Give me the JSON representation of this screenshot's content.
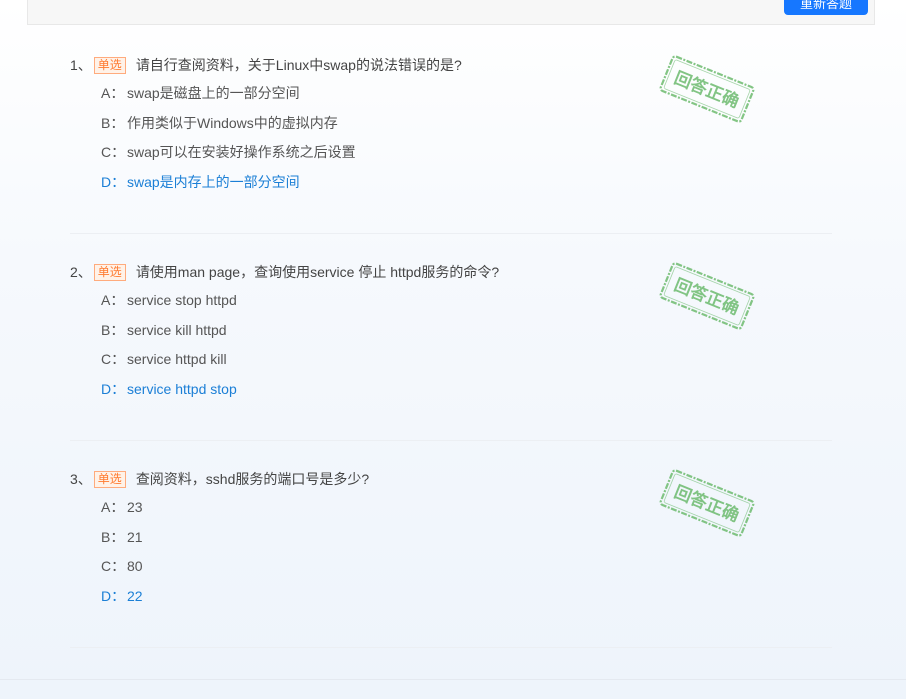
{
  "toolbar": {
    "redo_label": "重新答题"
  },
  "stamp_text": "回答正确",
  "colors": {
    "accent": "#1677ff",
    "correct": "#1b7fd6",
    "stamp": "#4caf50",
    "badge": "#ff7a2f"
  },
  "questions": [
    {
      "num": "1、",
      "type": "单选",
      "text": "请自行查阅资料，关于Linux中swap的说法错误的是?",
      "options": [
        {
          "letter": "A：",
          "text": "swap是磁盘上的一部分空间"
        },
        {
          "letter": "B：",
          "text": "作用类似于Windows中的虚拟内存"
        },
        {
          "letter": "C：",
          "text": "swap可以在安装好操作系统之后设置"
        },
        {
          "letter": "D：",
          "text": "swap是内存上的一部分空间"
        }
      ],
      "correct_option": "D",
      "result": "回答正确"
    },
    {
      "num": "2、",
      "type": "单选",
      "text": "请使用man page，查询使用service 停止 httpd服务的命令?",
      "options": [
        {
          "letter": "A：",
          "text": "service stop httpd"
        },
        {
          "letter": "B：",
          "text": "service kill httpd"
        },
        {
          "letter": "C：",
          "text": "service httpd kill"
        },
        {
          "letter": "D：",
          "text": "service httpd stop"
        }
      ],
      "correct_option": "D",
      "result": "回答正确"
    },
    {
      "num": "3、",
      "type": "单选",
      "text": "查阅资料，sshd服务的端口号是多少?",
      "options": [
        {
          "letter": "A：",
          "text": "23"
        },
        {
          "letter": "B：",
          "text": "21"
        },
        {
          "letter": "C：",
          "text": "80"
        },
        {
          "letter": "D：",
          "text": "22"
        }
      ],
      "correct_option": "D",
      "result": "回答正确"
    }
  ]
}
